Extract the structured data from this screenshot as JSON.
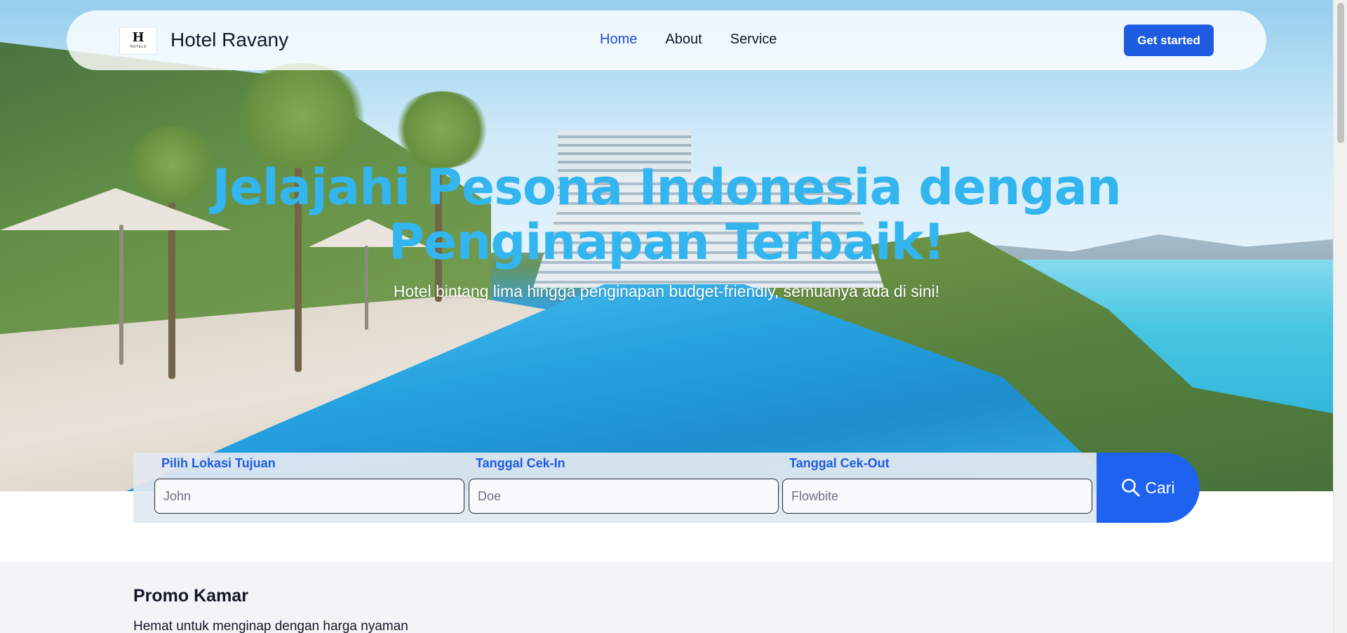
{
  "navbar": {
    "logo_mark": "H",
    "logo_sub": "HOTELS",
    "brand": "Hotel Ravany",
    "links": [
      {
        "label": "Home",
        "active": true
      },
      {
        "label": "About",
        "active": false
      },
      {
        "label": "Service",
        "active": false
      }
    ],
    "cta_label": "Get started"
  },
  "hero": {
    "title_line1": "Jelajahi Pesona Indonesia dengan",
    "title_line2": "Penginapan Terbaik!",
    "subtitle": "Hotel bintang lima hingga penginapan budget-friendly, semuanya ada di sini!"
  },
  "search": {
    "fields": [
      {
        "label": "Pilih Lokasi Tujuan",
        "placeholder": "John"
      },
      {
        "label": "Tanggal Cek-In",
        "placeholder": "Doe"
      },
      {
        "label": "Tanggal Cek-Out",
        "placeholder": "Flowbite"
      }
    ],
    "button_label": "Cari"
  },
  "promo": {
    "title": "Promo Kamar",
    "subtitle": "Hemat untuk menginap dengan harga nyaman"
  },
  "colors": {
    "accent": "#1d5be0",
    "hero_title": "#33b5ef",
    "search_button": "#1d63f0"
  }
}
